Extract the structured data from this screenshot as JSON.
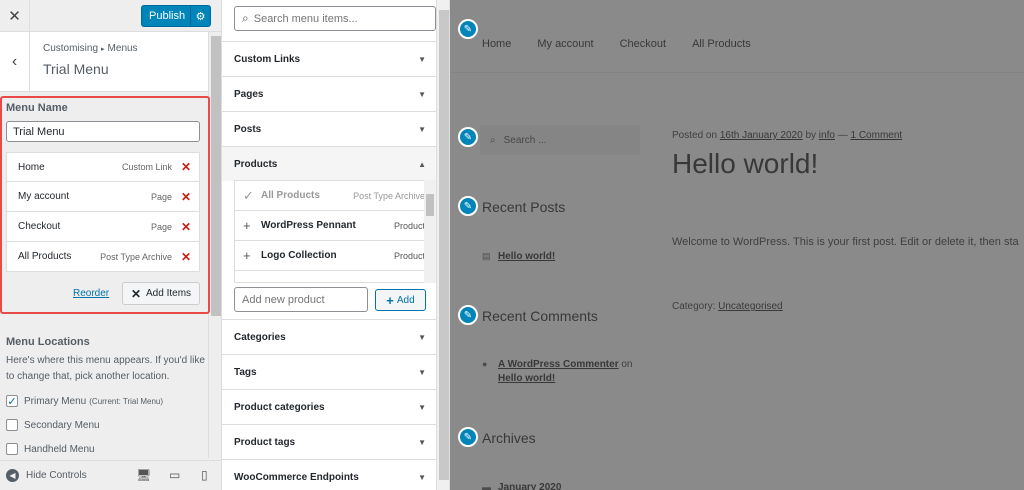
{
  "topbar": {
    "close_icon": "close-icon",
    "publish_label": "Publish",
    "gear_icon": "gear-icon"
  },
  "section": {
    "breadcrumb_parent": "Customising",
    "breadcrumb_child": "Menus",
    "title": "Trial Menu"
  },
  "menu": {
    "name_label": "Menu Name",
    "name_value": "Trial Menu",
    "items": [
      {
        "title": "Home",
        "type": "Custom Link"
      },
      {
        "title": "My account",
        "type": "Page"
      },
      {
        "title": "Checkout",
        "type": "Page"
      },
      {
        "title": "All Products",
        "type": "Post Type Archive"
      }
    ],
    "reorder_label": "Reorder",
    "add_items_label": "Add Items"
  },
  "locations": {
    "title": "Menu Locations",
    "description": "Here's where this menu appears. If you'd like to change that, pick another location.",
    "items": [
      {
        "label": "Primary Menu",
        "note": "(Current: Trial Menu)",
        "checked": true
      },
      {
        "label": "Secondary Menu",
        "note": "",
        "checked": false
      },
      {
        "label": "Handheld Menu",
        "note": "",
        "checked": false
      }
    ]
  },
  "footer": {
    "hide_controls_label": "Hide Controls"
  },
  "add_panel": {
    "search_placeholder": "Search menu items...",
    "sections": [
      "Custom Links",
      "Pages",
      "Posts",
      "Products",
      "Categories",
      "Tags",
      "Product categories",
      "Product tags",
      "WooCommerce Endpoints"
    ],
    "products": [
      {
        "name": "All Products",
        "type": "Post Type Archive",
        "added": true
      },
      {
        "name": "WordPress Pennant",
        "type": "Product",
        "added": false
      },
      {
        "name": "Logo Collection",
        "type": "Product",
        "added": false
      }
    ],
    "new_product_placeholder": "Add new product",
    "add_label": "Add"
  },
  "preview": {
    "nav": [
      "Home",
      "My account",
      "Checkout",
      "All Products"
    ],
    "search_placeholder": "Search ...",
    "post_meta_prefix": "Posted on",
    "post_date": "16th January 2020",
    "post_by": "by",
    "post_author": "info",
    "post_comments": "1 Comment",
    "post_title": "Hello world!",
    "post_body": "Welcome to WordPress. This is your first post. Edit or delete it, then sta",
    "category_label": "Category:",
    "category_value": "Uncategorised",
    "recent_posts_title": "Recent Posts",
    "recent_post_link": "Hello world!",
    "recent_comments_title": "Recent Comments",
    "comment_author": "A WordPress Commenter",
    "comment_on": "on",
    "comment_post": "Hello world!",
    "archives_title": "Archives",
    "archive_link": "January 2020"
  }
}
